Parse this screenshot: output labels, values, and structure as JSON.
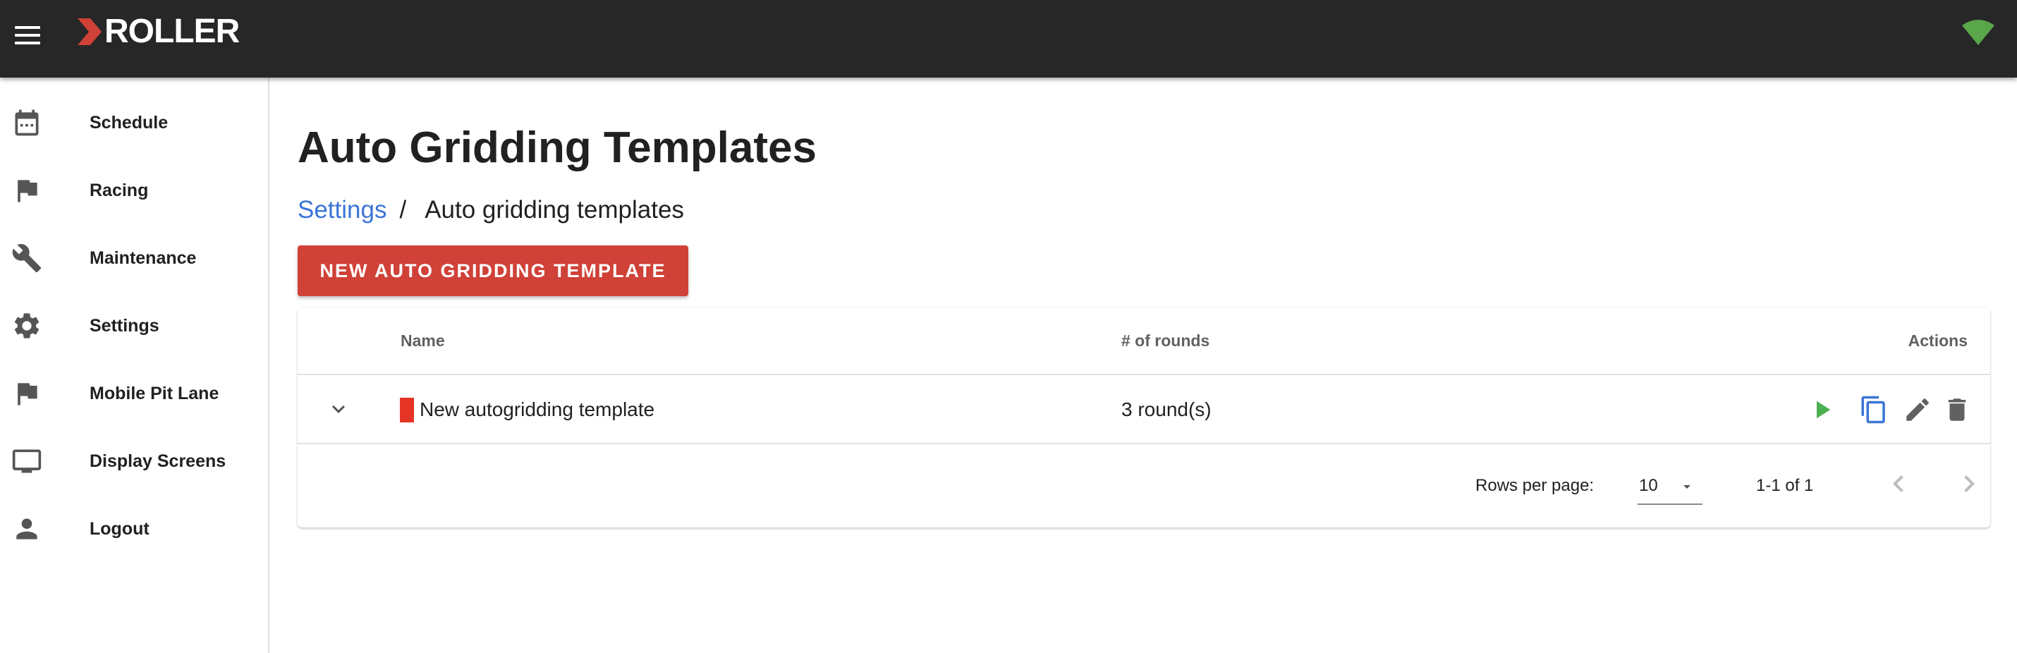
{
  "app": {
    "brand": "ROLLER",
    "brand_color": "#d04137",
    "header_bg": "#272727"
  },
  "sidebar": {
    "items": [
      {
        "label": "Schedule",
        "icon": "calendar-icon"
      },
      {
        "label": "Racing",
        "icon": "flag-icon"
      },
      {
        "label": "Maintenance",
        "icon": "wrench-icon"
      },
      {
        "label": "Settings",
        "icon": "gear-icon"
      },
      {
        "label": "Mobile Pit Lane",
        "icon": "flag-icon"
      },
      {
        "label": "Display Screens",
        "icon": "monitor-icon"
      },
      {
        "label": "Logout",
        "icon": "person-icon"
      }
    ]
  },
  "main": {
    "title": "Auto Gridding Templates",
    "breadcrumb": {
      "link": "Settings",
      "separator": "/",
      "current": "Auto gridding templates"
    },
    "new_button": "NEW AUTO GRIDDING TEMPLATE"
  },
  "table": {
    "headers": {
      "name": "Name",
      "rounds": "# of rounds",
      "actions": "Actions"
    },
    "rows": [
      {
        "name": "New autogridding template",
        "rounds": "3 round(s)",
        "color": "#e53426"
      }
    ],
    "action_icons": [
      "play-icon",
      "copy-icon",
      "edit-icon",
      "delete-icon"
    ],
    "footer": {
      "rows_per_page_label": "Rows per page:",
      "rows_per_page": "10",
      "page_info": "1-1 of 1"
    }
  }
}
